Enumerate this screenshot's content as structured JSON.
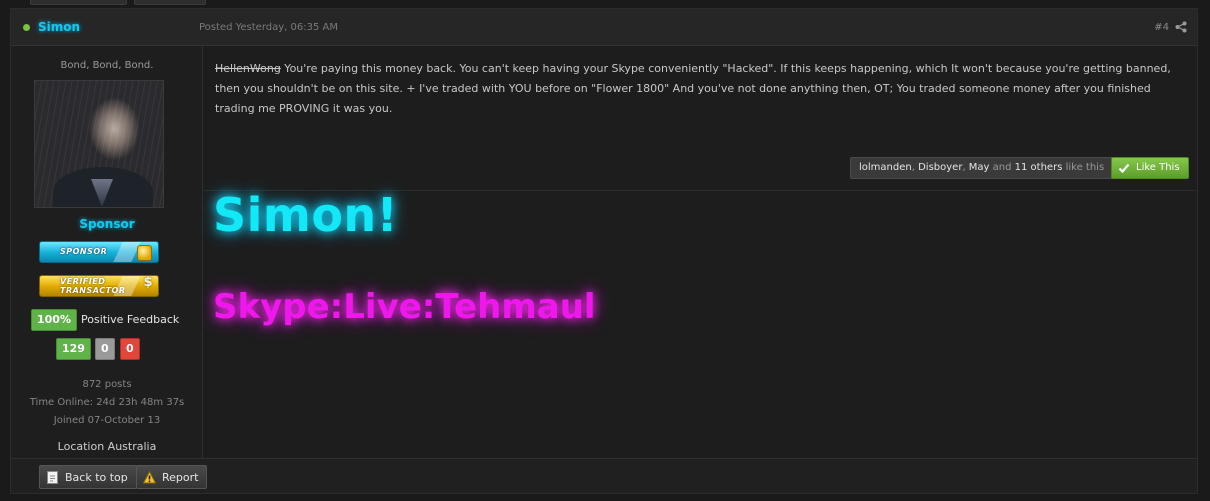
{
  "post": {
    "author": "Simon",
    "posted": "Posted Yesterday, 06:35 AM",
    "number": "#4",
    "user": {
      "title": "Bond, Bond, Bond.",
      "rank": "Sponsor",
      "badges": {
        "sponsor": "SPONSOR",
        "verified_line1": "VERIFIED",
        "verified_line2": "TRANSACTOR"
      },
      "feedback_pct": "100%",
      "feedback_label": "Positive Feedback",
      "positive": "129",
      "neutral": "0",
      "negative": "0",
      "posts": "872 posts",
      "time_online": "Time Online: 24d 23h 48m 37s",
      "joined": "Joined 07-October 13",
      "location": "Location Australia"
    },
    "message": {
      "quoted_user": "HellenWong",
      "text": " You're paying this money back. You can't keep having your Skype conveniently \"Hacked\". If this keeps happening, which It won't because you're getting banned, then you shouldn't be on this site. + I've traded with YOU before on \"Flower 1800\" And you've not done anything then, OT; You traded someone money after you finished trading me PROVING it was you."
    },
    "likes": {
      "u1": "lolmanden",
      "sep1": ", ",
      "u2": "Disboyer",
      "sep2": ", ",
      "u3": "May",
      "and": " and ",
      "others": "11 others",
      "suffix": " like this"
    },
    "like_button": "Like This",
    "signature": {
      "line1": "Simon!",
      "line2": "Skype:Live:Tehmaul"
    },
    "footer": {
      "back_to_top": "Back to top",
      "report": "Report"
    }
  },
  "colors": {
    "name_cyan": "#14c8f0",
    "sig_cyan": "#12e8f6",
    "sig_magenta": "#ee18ec",
    "green": "#5fb348",
    "red": "#e0463a"
  },
  "icons": [
    "share-icon",
    "check-icon",
    "back-to-top-icon",
    "warning-icon"
  ]
}
